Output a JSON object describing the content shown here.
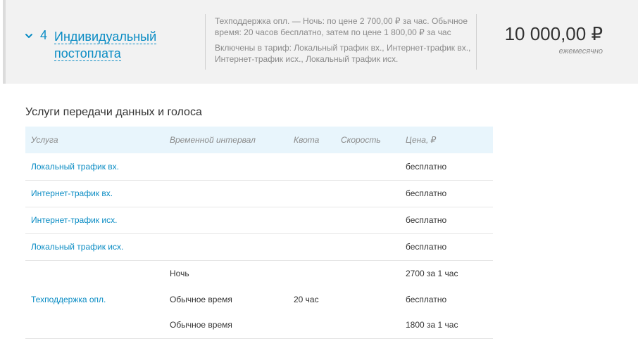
{
  "tariff": {
    "number": "4",
    "name": "Индивидуальный постоплата",
    "description_line1": "Техподдержка опл. — Ночь: по цене 2 700,00 ₽ за час. Обычное время: 20 часов бесплатно, затем по цене 1 800,00 ₽ за час",
    "description_line2": "Включены в тариф: Локальный трафик вх., Интернет-трафик вх., Интернет-трафик исх., Локальный трафик исх.",
    "price": "10 000,00 ₽",
    "period": "ежемесячно",
    "icon": "chevron-down-icon"
  },
  "section": {
    "title": "Услуги передачи данных и голоса"
  },
  "table": {
    "headers": [
      "Услуга",
      "Временной интервал",
      "Квота",
      "Скорость",
      "Цена, ₽"
    ],
    "rows": [
      {
        "service": "Локальный трафик вх.",
        "price": "бесплатно"
      },
      {
        "service": "Интернет-трафик вх.",
        "price": "бесплатно"
      },
      {
        "service": "Интернет-трафик исх.",
        "price": "бесплатно"
      },
      {
        "service": "Локальный трафик исх.",
        "price": "бесплатно"
      }
    ],
    "support": {
      "service": "Техподдержка опл.",
      "intervals": [
        {
          "interval": "Ночь",
          "quota": "",
          "price": "2700 за 1 час"
        },
        {
          "interval": "Обычное время",
          "quota": "20 час",
          "price": "бесплатно"
        },
        {
          "interval": "Обычное время",
          "quota": "",
          "price": "1800 за 1 час"
        }
      ]
    }
  },
  "colors": {
    "link": "#0a8cc4",
    "header_bg": "#f2f2f2",
    "table_header_bg": "#e8f5fc"
  }
}
